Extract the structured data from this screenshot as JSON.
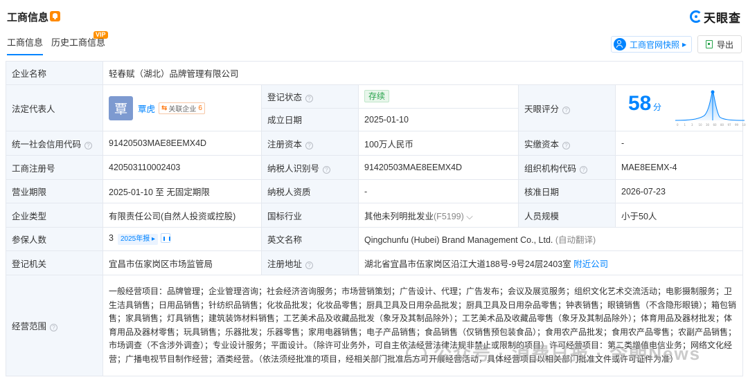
{
  "header": {
    "title": "工商信息",
    "logo_text": "天眼查",
    "brand_color": "#0084ff",
    "bell_icon": "bell-icon"
  },
  "tabs": [
    {
      "label": "工商信息",
      "active": true
    },
    {
      "label": "历史工商信息",
      "badge": "VIP"
    }
  ],
  "toolbar": {
    "snapshot_label": "工商官网快照",
    "export_label": "导出"
  },
  "table": {
    "company_name_k": "企业名称",
    "company_name_v": "轻春赋（湖北）品牌管理有限公司",
    "legal_rep_k": "法定代表人",
    "legal_rep_avatar": "覃",
    "legal_rep_name": "覃虎",
    "legal_rep_tag": "关联企业",
    "legal_rep_count": "6",
    "reg_status_k": "登记状态",
    "reg_status_v": "存续",
    "est_date_k": "成立日期",
    "est_date_v": "2025-01-10",
    "score_k": "天眼评分",
    "score_v": "58",
    "score_unit": "分",
    "score_axis": [
      "0",
      "1",
      "3",
      "10",
      "30",
      "60",
      "80",
      "97",
      "99",
      "100"
    ],
    "credit_code_k": "统一社会信用代码",
    "credit_code_v": "91420503MAE8EEMX4D",
    "reg_capital_k": "注册资本",
    "reg_capital_v": "100万人民币",
    "paid_capital_k": "实缴资本",
    "paid_capital_v": "-",
    "reg_no_k": "工商注册号",
    "reg_no_v": "420503110002403",
    "taxpayer_id_k": "纳税人识别号",
    "taxpayer_id_v": "91420503MAE8EEMX4D",
    "org_code_k": "组织机构代码",
    "org_code_v": "MAE8EEMX-4",
    "term_k": "营业期限",
    "term_v": "2025-01-10 至 无固定期限",
    "taxpayer_q_k": "纳税人资质",
    "taxpayer_q_v": "-",
    "approve_date_k": "核准日期",
    "approve_date_v": "2026-07-23",
    "type_k": "企业类型",
    "type_v": "有限责任公司(自然人投资或控股)",
    "industry_k": "国标行业",
    "industry_v": "其他未列明批发业",
    "industry_code": "(F5199)",
    "staff_k": "人员规模",
    "staff_v": "小于50人",
    "insured_k": "参保人数",
    "insured_v": "3",
    "insured_year": "2025年报",
    "en_name_k": "英文名称",
    "en_name_v": "Qingchunfu (Hubei) Brand Management Co., Ltd.",
    "en_name_note": "(自动翻译)",
    "authority_k": "登记机关",
    "authority_v": "宜昌市伍家岗区市场监管局",
    "address_k": "注册地址",
    "address_v": "湖北省宜昌市伍家岗区沿江大道188号-9号24层2403室",
    "address_link": "附近公司",
    "scope_k": "经营范围",
    "scope_v": "一般经营项目：品牌管理；企业管理咨询；社会经济咨询服务；市场营销策划；广告设计、代理；广告发布；会议及展览服务；组织文化艺术交流活动；电影摄制服务；卫生洁具销售；日用品销售；针纺织品销售；化妆品批发；化妆品零售；厨具卫具及日用杂品批发；厨具卫具及日用杂品零售；钟表销售；眼镜销售（不含隐形眼镜）；箱包销售；家具销售；灯具销售；建筑装饰材料销售；工艺美术品及收藏品批发（象牙及其制品除外）；工艺美术品及收藏品零售（象牙及其制品除外）；体育用品及器材批发；体育用品及器材零售；玩具销售；乐器批发；乐器零售；家用电器销售；电子产品销售；食品销售（仅销售预包装食品）；食用农产品批发；食用农产品零售；农副产品销售；市场调查（不含涉外调查）；专业设计服务；平面设计。（除许可业务外，可自主依法经营法律法规非禁止或限制的项目）许可经营项目：第二类增值电信业务；网络文化经营；广播电视节目制作经营；酒类经营。（依法须经批准的项目，经相关部门批准后方可开展经营活动，具体经营项目以相关部门批准文件或许可证件为准）"
  },
  "watermark": "公众号 · 消费日报 · 今朝News"
}
